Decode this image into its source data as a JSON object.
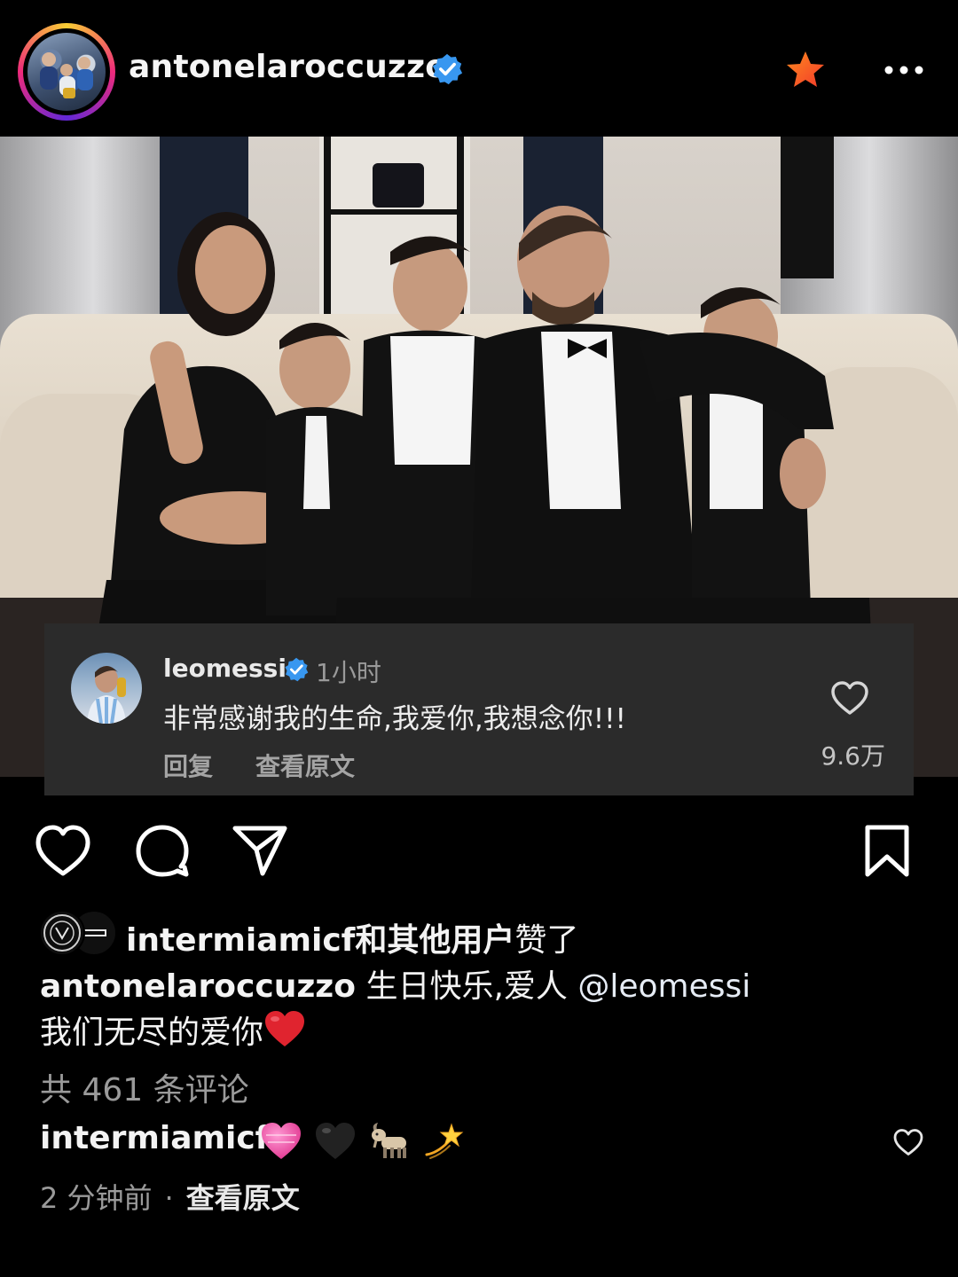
{
  "header": {
    "username": "antonelaroccuzzo",
    "verified": true,
    "star_icon": "star-icon",
    "more_icon": "more-icon",
    "ring_colors": [
      "#f9ce34",
      "#ee2a7b",
      "#6228d7"
    ]
  },
  "photo": {
    "description_icon": "family-photo"
  },
  "comment_overlay": {
    "username": "leomessi",
    "verified": true,
    "time": "1小时",
    "text": "非常感谢我的生命,我爱你,我想念你!!!",
    "reply_label": "回复",
    "view_original_label": "查看原文",
    "likes": "9.6万"
  },
  "actions": {
    "like_icon": "heart-icon",
    "comment_icon": "comment-icon",
    "share_icon": "send-icon",
    "save_icon": "bookmark-icon"
  },
  "likes_line": {
    "first_user": "intermiamicf",
    "connector_bold": "和其他用户",
    "suffix": "赞了"
  },
  "caption": {
    "username": "antonelaroccuzzo",
    "text": "生日快乐,爱人",
    "mention": "@leomessi",
    "line2": "我们无尽的爱你"
  },
  "comments_count": "共 461 条评论",
  "top_comment": {
    "username": "intermiamicf",
    "emojis": [
      "pink-heart",
      "black-heart",
      "goat",
      "dizzy"
    ],
    "time": "2 分钟前",
    "dot": "·",
    "view_original_label": "查看原文"
  },
  "colors": {
    "background": "#000000",
    "verified_blue": "#3897f0",
    "star_orange": "#ff5a1f",
    "heart_red": "#e0242f"
  }
}
